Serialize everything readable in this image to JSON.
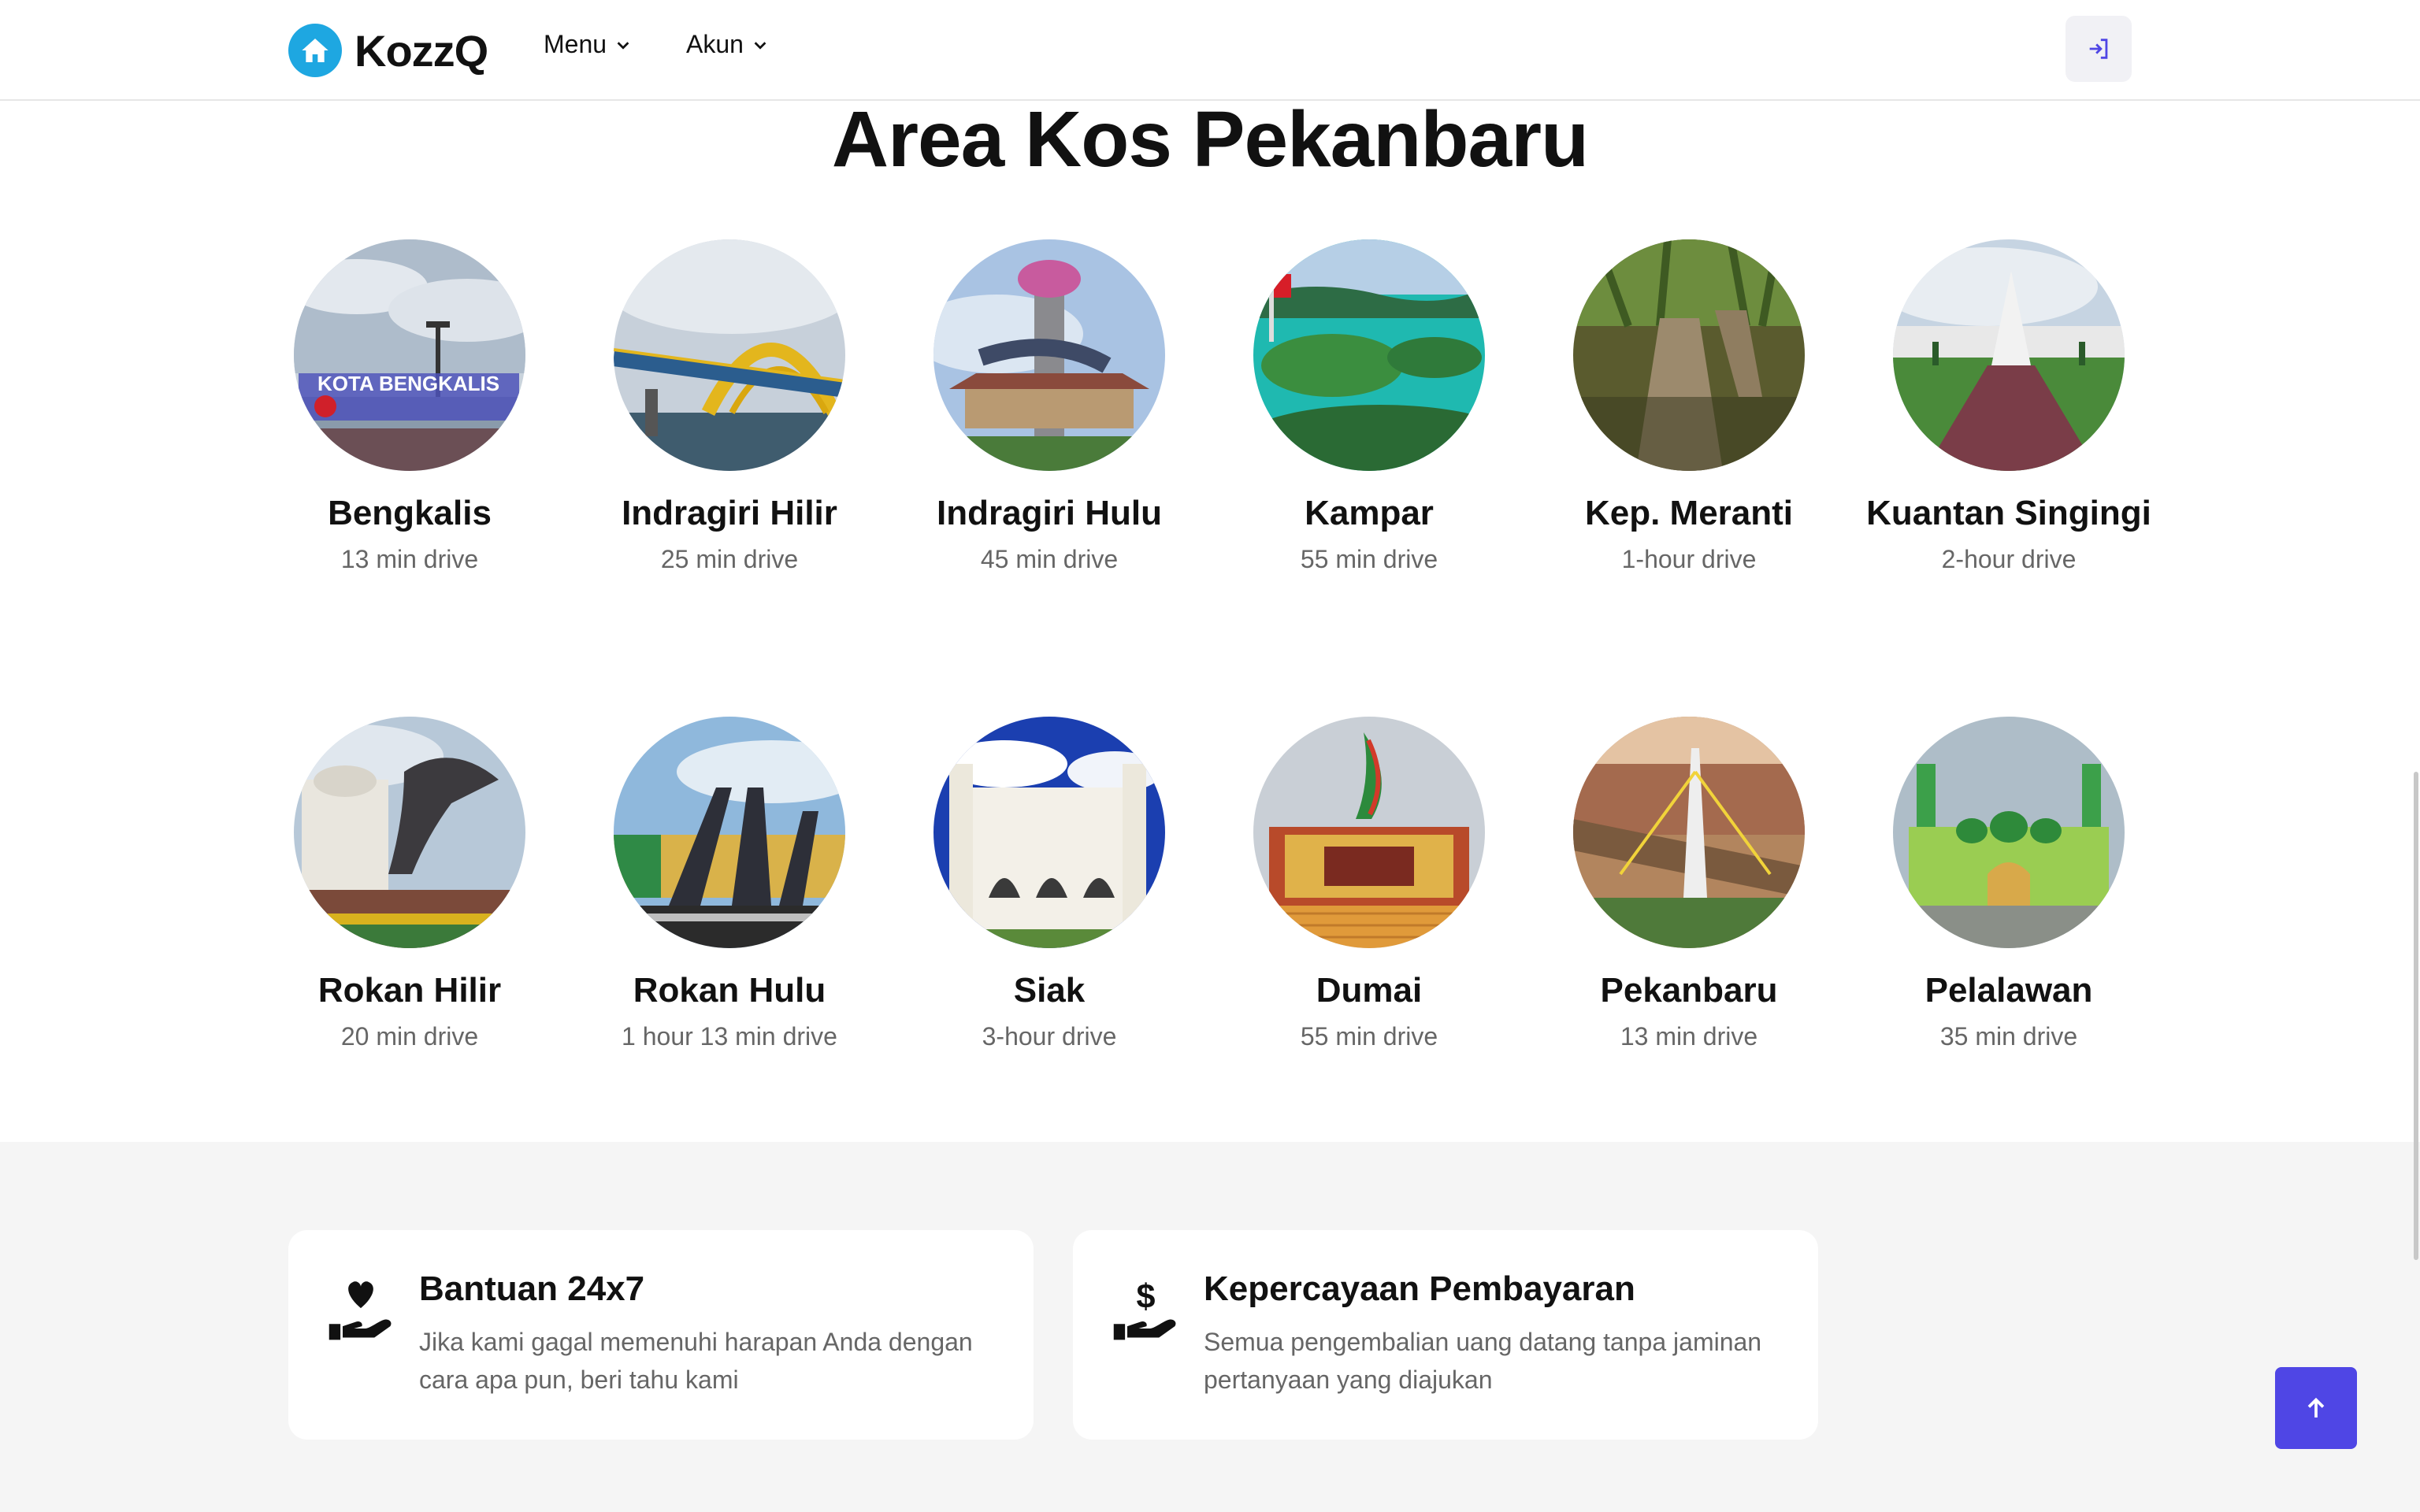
{
  "header": {
    "brand": "KozzQ",
    "nav": [
      {
        "label": "Menu"
      },
      {
        "label": "Akun"
      }
    ],
    "login_icon": "login-icon"
  },
  "section": {
    "title": "Area Kos Pekanbaru",
    "areas": [
      {
        "name": "Bengkalis",
        "time": "13 min drive"
      },
      {
        "name": "Indragiri Hilir",
        "time": "25 min drive"
      },
      {
        "name": "Indragiri Hulu",
        "time": "45 min drive"
      },
      {
        "name": "Kampar",
        "time": "55 min drive"
      },
      {
        "name": "Kep. Meranti",
        "time": "1-hour drive"
      },
      {
        "name": "Kuantan Singingi",
        "time": "2-hour drive"
      },
      {
        "name": "Rokan Hilir",
        "time": "20 min drive"
      },
      {
        "name": "Rokan Hulu",
        "time": "1 hour 13 min drive"
      },
      {
        "name": "Siak",
        "time": "3-hour drive"
      },
      {
        "name": "Dumai",
        "time": "55 min drive"
      },
      {
        "name": "Pekanbaru",
        "time": "13 min drive"
      },
      {
        "name": "Pelalawan",
        "time": "35 min drive"
      }
    ],
    "photo_sign_text": "KOTA BENGKALIS"
  },
  "features": [
    {
      "icon": "hand-heart-icon",
      "title": "Bantuan 24x7",
      "desc": "Jika kami gagal memenuhi harapan Anda dengan cara apa pun, beri tahu kami"
    },
    {
      "icon": "hand-dollar-icon",
      "title": "Kepercayaan Pembayaran",
      "desc": "Semua pengembalian uang datang tanpa jaminan pertanyaan yang diajukan"
    }
  ],
  "colors": {
    "brand": "#1ea7e1",
    "accent": "#4f46e5",
    "band": "#f5f5f5"
  }
}
